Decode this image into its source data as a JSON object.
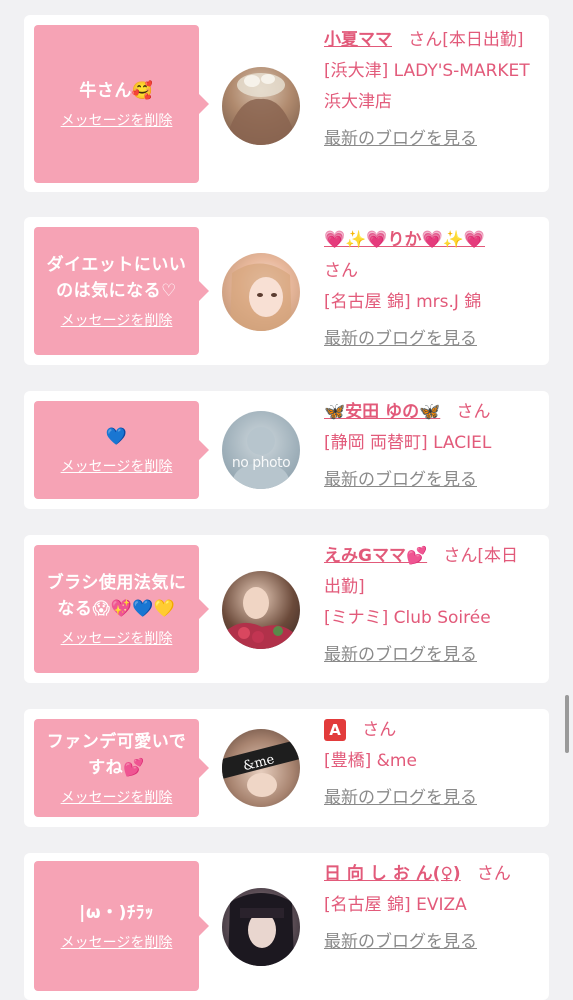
{
  "colors": {
    "accent": "#e25a7a",
    "bubble": "#f6a3b5",
    "background": "#f1f1f3",
    "card": "#ffffff",
    "link_gray": "#8a8a8a"
  },
  "common": {
    "delete_label": "メッセージを削除",
    "blog_label": "最新のブログを見る",
    "san_label": "さん"
  },
  "items": [
    {
      "message": "牛さん🥰",
      "name": "小夏ママ",
      "san": "さん[本日出勤]",
      "shop": "[浜大津] LADY'S-MARKET 浜大津店"
    },
    {
      "message": "ダイエットにいいのは気になる♡",
      "name": "💗✨💗りか💗✨💗",
      "san": "さん",
      "shop": "[名古屋 錦] mrs.J 錦"
    },
    {
      "message": "💙",
      "name": "🦋安田 ゆの🦋",
      "san": "さん",
      "shop": "[静岡 両替町] LACIEL",
      "avatar_text": "no photo"
    },
    {
      "message": "ブラシ使用法気になる😱💖💙💛",
      "name": "えみGママ💕",
      "san": "さん[本日出勤]",
      "shop": "[ミナミ] Club Soirée"
    },
    {
      "message": "ファンデ可愛いですね💕",
      "name": "A",
      "san": "さん",
      "shop": "[豊橋] &me",
      "avatar_text": "&me"
    },
    {
      "message": "|ω・)ﾁﾗｯ",
      "name": "日 向 し お ん(♀)",
      "san": "さん",
      "shop": "[名古屋 錦] EVIZA"
    }
  ]
}
